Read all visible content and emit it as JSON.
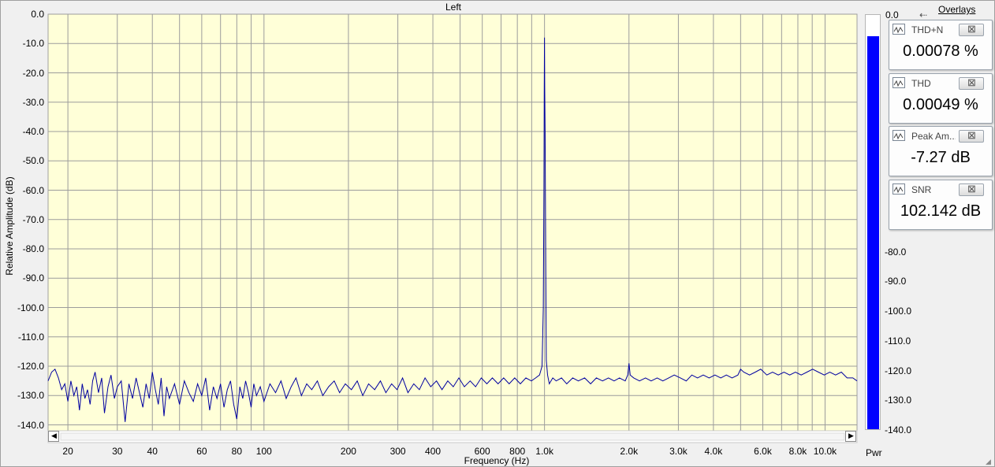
{
  "header": {
    "channel_label": "Left",
    "overlays_link": "Overlays"
  },
  "meter": {
    "label": "Pwr",
    "top_tick": "0.0",
    "ticks": [
      "-80.0",
      "-90.0",
      "-100.0",
      "-110.0",
      "-120.0",
      "-130.0",
      "-140.0"
    ],
    "level_db": -7.27,
    "range": [
      -140,
      0
    ],
    "color": "#0000ff"
  },
  "panels": [
    {
      "name": "THD+N",
      "value": "0.00078 %"
    },
    {
      "name": "THD",
      "value": "0.00049 %"
    },
    {
      "name": "Peak Am...",
      "value": "-7.27 dB"
    },
    {
      "name": "SNR",
      "value": "102.142 dB"
    }
  ],
  "chart_data": {
    "type": "line",
    "title": "Left",
    "xlabel": "Frequency (Hz)",
    "ylabel": "Relative Amplitude (dB)",
    "x_scale": "log",
    "xlim": [
      17,
      13000
    ],
    "ylim": [
      -142,
      0
    ],
    "grid": true,
    "background": "#ffffd8",
    "line_color": "#0000a0",
    "y_ticks": [
      "0.0",
      "-10.0",
      "-20.0",
      "-30.0",
      "-40.0",
      "-50.0",
      "-60.0",
      "-70.0",
      "-80.0",
      "-90.0",
      "-100.0",
      "-110.0",
      "-120.0",
      "-130.0",
      "-140.0"
    ],
    "x_tick_labels": [
      {
        "x": 20,
        "label": "20"
      },
      {
        "x": 30,
        "label": "30"
      },
      {
        "x": 40,
        "label": "40"
      },
      {
        "x": 60,
        "label": "60"
      },
      {
        "x": 80,
        "label": "80"
      },
      {
        "x": 100,
        "label": "100"
      },
      {
        "x": 200,
        "label": "200"
      },
      {
        "x": 300,
        "label": "300"
      },
      {
        "x": 400,
        "label": "400"
      },
      {
        "x": 600,
        "label": "600"
      },
      {
        "x": 800,
        "label": "800"
      },
      {
        "x": 1000,
        "label": "1.0k"
      },
      {
        "x": 2000,
        "label": "2.0k"
      },
      {
        "x": 3000,
        "label": "3.0k"
      },
      {
        "x": 4000,
        "label": "4.0k"
      },
      {
        "x": 6000,
        "label": "6.0k"
      },
      {
        "x": 8000,
        "label": "8.0k"
      },
      {
        "x": 10000,
        "label": "10.0k"
      }
    ],
    "series": [
      {
        "points": [
          [
            17,
            -125
          ],
          [
            17.5,
            -122
          ],
          [
            18,
            -121
          ],
          [
            18.5,
            -124
          ],
          [
            19,
            -128
          ],
          [
            19.5,
            -126
          ],
          [
            20,
            -132
          ],
          [
            20.5,
            -125
          ],
          [
            21,
            -130
          ],
          [
            21.5,
            -127
          ],
          [
            22,
            -135
          ],
          [
            22.5,
            -126
          ],
          [
            23,
            -131
          ],
          [
            23.5,
            -128
          ],
          [
            24,
            -133
          ],
          [
            24.5,
            -125
          ],
          [
            25,
            -122
          ],
          [
            25.7,
            -129
          ],
          [
            26.4,
            -124
          ],
          [
            27,
            -136
          ],
          [
            27.8,
            -127
          ],
          [
            28.5,
            -123
          ],
          [
            29.3,
            -131
          ],
          [
            30,
            -127
          ],
          [
            31,
            -125
          ],
          [
            32,
            -139
          ],
          [
            33,
            -126
          ],
          [
            34,
            -131
          ],
          [
            35,
            -124
          ],
          [
            36,
            -129
          ],
          [
            37,
            -134
          ],
          [
            38,
            -126
          ],
          [
            39,
            -131
          ],
          [
            40,
            -122
          ],
          [
            41,
            -128
          ],
          [
            42,
            -133
          ],
          [
            43,
            -124
          ],
          [
            44,
            -137
          ],
          [
            45,
            -127
          ],
          [
            46,
            -131
          ],
          [
            48,
            -126
          ],
          [
            50,
            -133
          ],
          [
            52,
            -125
          ],
          [
            54,
            -129
          ],
          [
            56,
            -132
          ],
          [
            58,
            -126
          ],
          [
            60,
            -130
          ],
          [
            62,
            -124
          ],
          [
            64,
            -135
          ],
          [
            66,
            -127
          ],
          [
            68,
            -131
          ],
          [
            70,
            -126
          ],
          [
            72,
            -134
          ],
          [
            74,
            -128
          ],
          [
            76,
            -125
          ],
          [
            78,
            -133
          ],
          [
            80,
            -138
          ],
          [
            82,
            -127
          ],
          [
            84,
            -131
          ],
          [
            86,
            -125
          ],
          [
            88,
            -129
          ],
          [
            90,
            -134
          ],
          [
            92,
            -126
          ],
          [
            94,
            -130
          ],
          [
            97,
            -127
          ],
          [
            100,
            -132
          ],
          [
            105,
            -126
          ],
          [
            110,
            -129
          ],
          [
            115,
            -125
          ],
          [
            120,
            -131
          ],
          [
            125,
            -127
          ],
          [
            130,
            -124
          ],
          [
            136,
            -130
          ],
          [
            142,
            -126
          ],
          [
            148,
            -128
          ],
          [
            155,
            -125
          ],
          [
            162,
            -130
          ],
          [
            170,
            -127
          ],
          [
            178,
            -125
          ],
          [
            186,
            -129
          ],
          [
            195,
            -126
          ],
          [
            205,
            -128
          ],
          [
            215,
            -125
          ],
          [
            225,
            -130
          ],
          [
            236,
            -126
          ],
          [
            248,
            -128
          ],
          [
            260,
            -125
          ],
          [
            272,
            -129
          ],
          [
            285,
            -126
          ],
          [
            298,
            -128
          ],
          [
            312,
            -124
          ],
          [
            326,
            -129
          ],
          [
            342,
            -126
          ],
          [
            358,
            -128
          ],
          [
            375,
            -124
          ],
          [
            393,
            -127
          ],
          [
            412,
            -125
          ],
          [
            431,
            -128
          ],
          [
            452,
            -125
          ],
          [
            473,
            -127
          ],
          [
            495,
            -124
          ],
          [
            518,
            -127
          ],
          [
            543,
            -125
          ],
          [
            568,
            -127
          ],
          [
            595,
            -124
          ],
          [
            623,
            -126
          ],
          [
            652,
            -124
          ],
          [
            683,
            -126
          ],
          [
            715,
            -124
          ],
          [
            748,
            -126
          ],
          [
            783,
            -124
          ],
          [
            820,
            -126
          ],
          [
            858,
            -124
          ],
          [
            898,
            -125
          ],
          [
            930,
            -124
          ],
          [
            960,
            -123
          ],
          [
            980,
            -120
          ],
          [
            990,
            -100
          ],
          [
            995,
            -60
          ],
          [
            998,
            -25
          ],
          [
            1000,
            -8
          ],
          [
            1002,
            -25
          ],
          [
            1005,
            -40
          ],
          [
            1010,
            -85
          ],
          [
            1015,
            -118
          ],
          [
            1025,
            -123
          ],
          [
            1040,
            -126
          ],
          [
            1070,
            -124
          ],
          [
            1100,
            -125
          ],
          [
            1150,
            -124
          ],
          [
            1200,
            -126
          ],
          [
            1260,
            -124
          ],
          [
            1320,
            -125
          ],
          [
            1390,
            -124
          ],
          [
            1460,
            -126
          ],
          [
            1530,
            -124
          ],
          [
            1610,
            -125
          ],
          [
            1690,
            -124
          ],
          [
            1770,
            -125
          ],
          [
            1850,
            -124
          ],
          [
            1940,
            -125
          ],
          [
            1980,
            -123
          ],
          [
            2000,
            -119
          ],
          [
            2020,
            -123
          ],
          [
            2080,
            -124
          ],
          [
            2180,
            -125
          ],
          [
            2290,
            -124
          ],
          [
            2400,
            -125
          ],
          [
            2520,
            -124
          ],
          [
            2640,
            -125
          ],
          [
            2770,
            -124
          ],
          [
            2900,
            -123
          ],
          [
            3050,
            -124
          ],
          [
            3200,
            -125
          ],
          [
            3350,
            -123
          ],
          [
            3510,
            -124
          ],
          [
            3680,
            -123
          ],
          [
            3860,
            -124
          ],
          [
            4050,
            -123
          ],
          [
            4250,
            -124
          ],
          [
            4450,
            -123
          ],
          [
            4660,
            -124
          ],
          [
            4890,
            -123
          ],
          [
            5000,
            -121
          ],
          [
            5130,
            -122
          ],
          [
            5380,
            -123
          ],
          [
            5640,
            -122
          ],
          [
            5900,
            -121
          ],
          [
            6200,
            -123
          ],
          [
            6500,
            -122
          ],
          [
            6810,
            -123
          ],
          [
            7140,
            -122
          ],
          [
            7480,
            -123
          ],
          [
            7840,
            -122
          ],
          [
            8220,
            -123
          ],
          [
            8620,
            -122
          ],
          [
            9030,
            -121
          ],
          [
            9470,
            -122
          ],
          [
            9930,
            -123
          ],
          [
            10400,
            -122
          ],
          [
            10900,
            -123
          ],
          [
            11430,
            -122
          ],
          [
            11980,
            -124
          ],
          [
            12560,
            -124
          ],
          [
            13000,
            -125
          ]
        ]
      }
    ]
  }
}
